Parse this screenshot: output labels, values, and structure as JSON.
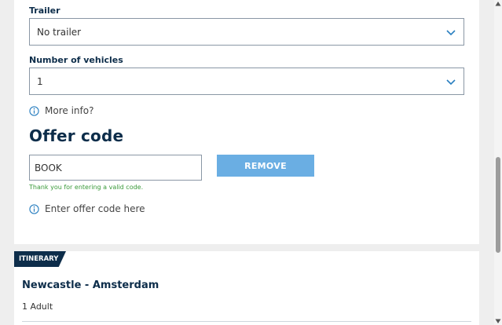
{
  "trailer": {
    "label": "Trailer",
    "selected": "No trailer"
  },
  "vehicles": {
    "label": "Number of vehicles",
    "selected": "1"
  },
  "more_info": {
    "text": "More info?",
    "icon": "info-icon"
  },
  "offer": {
    "title": "Offer code",
    "code_value": "BOOK",
    "remove_label": "REMOVE",
    "valid_message": "Thank you for entering a valid code.",
    "enter_link": "Enter offer code here"
  },
  "itinerary": {
    "tab": "ITINERARY",
    "route": "Newcastle - Amsterdam",
    "passengers": "1 Adult"
  },
  "colors": {
    "navy": "#0d2d4a",
    "button_blue": "#6aaee3",
    "success_green": "#3a9a3a",
    "info_blue": "#2a7fc0"
  }
}
